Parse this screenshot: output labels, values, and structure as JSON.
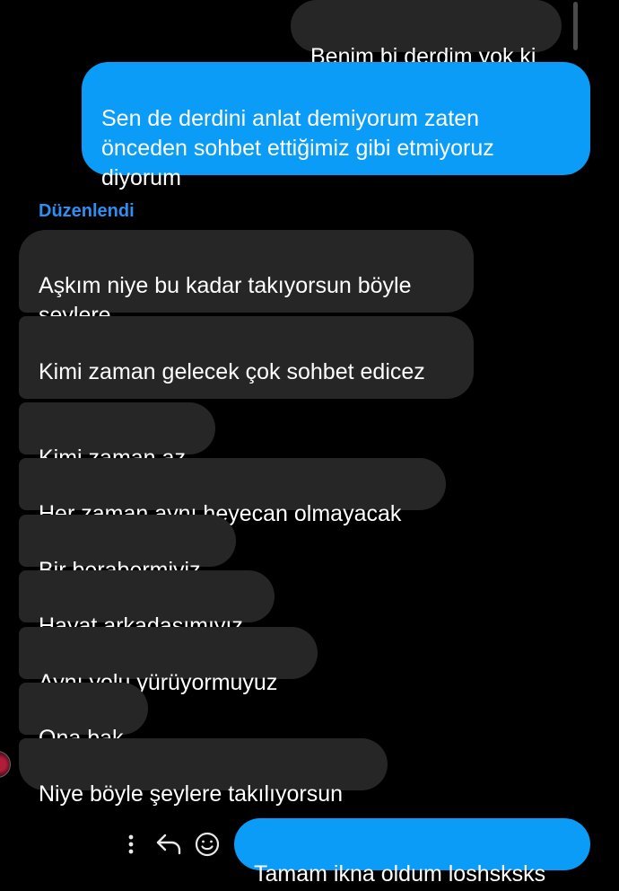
{
  "messages": {
    "outgoing_gray": "Benim bi derdim yok ki",
    "outgoing_blue": "Sen de derdini anlat demiyorum zaten önceden sohbet ettiğimiz gibi etmiyoruz diyorum",
    "edited_label": "Düzenlendi",
    "incoming": [
      "Aşkım niye bu kadar takıyorsun böyle şeylere",
      "Kimi zaman gelecek çok sohbet edicez",
      "Kimi zaman az",
      "Her zaman aynı heyecan olmayacak",
      "Bir berabermiyiz",
      "Hayat arkadaşımıyız",
      "Aynı yolu yürüyormuyuz",
      "Ona bak",
      "Niye böyle şeylere takılıyorsun"
    ],
    "last_outgoing": "Tamam ikna oldum loshsksks"
  },
  "icons": {
    "more": "more-vertical-icon",
    "reply": "reply-icon",
    "react": "smiley-icon"
  },
  "colors": {
    "background": "#000000",
    "incoming_bubble": "#262626",
    "outgoing_bubble": "#0a9cf7",
    "edited_text": "#2e8ff0"
  }
}
